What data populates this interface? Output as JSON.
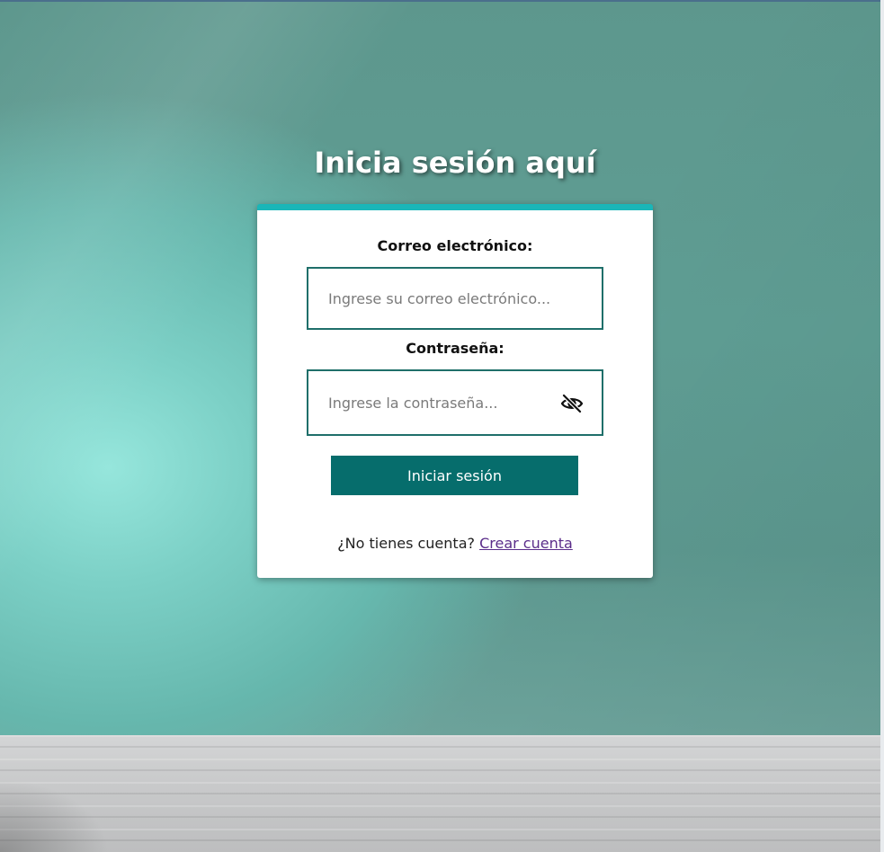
{
  "page": {
    "title": "Inicia sesión aquí"
  },
  "login_form": {
    "email_label": "Correo electrónico:",
    "email_placeholder": "Ingrese su correo electrónico...",
    "password_label": "Contraseña:",
    "password_placeholder": "Ingrese la contraseña...",
    "password_toggle_icon": "eye-slash-icon",
    "submit_label": "Iniciar sesión"
  },
  "register": {
    "prompt": "¿No tienes cuenta?",
    "link_label": "Crear cuenta"
  },
  "colors": {
    "accent_top_border": "#1ab6b8",
    "button_bg": "#066d6c",
    "input_border": "#1f6f6a",
    "link": "#5b2d8a"
  }
}
